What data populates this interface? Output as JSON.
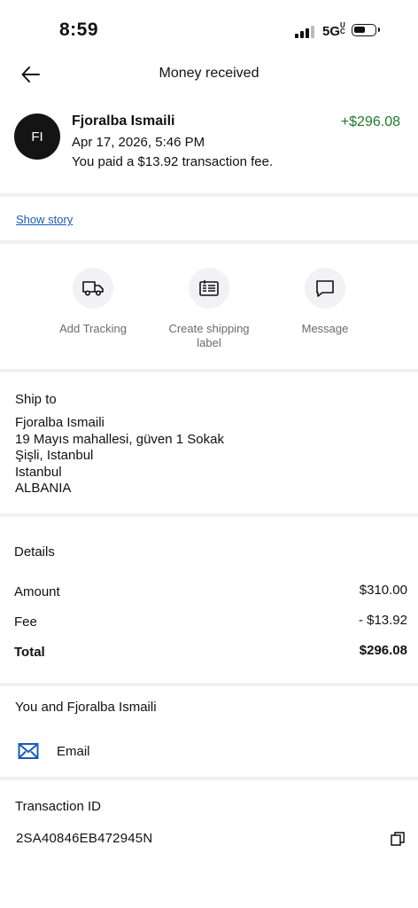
{
  "status_bar": {
    "time": "8:59",
    "network": "5G",
    "network_suffix": "UC"
  },
  "header": {
    "title": "Money received",
    "back_icon": "arrow-left-icon"
  },
  "summary": {
    "initials": "FI",
    "name": "Fjoralba Ismaili",
    "date": "Apr 17, 2026, 5:46 PM",
    "fee_note": "You paid a $13.92 transaction fee.",
    "amount": "+$296.08",
    "amount_color": "#1f7a2c"
  },
  "story_link": "Show story",
  "actions": [
    {
      "label": "Add Tracking",
      "icon": "truck-icon"
    },
    {
      "label": "Create shipping label",
      "icon": "shipping-label-icon"
    },
    {
      "label": "Message",
      "icon": "message-icon"
    }
  ],
  "ship_to": {
    "title": "Ship to",
    "lines": [
      "Fjoralba Ismaili",
      "19 Mayıs mahallesi, güven 1 Sokak",
      "Şişli, Istanbul",
      "Istanbul",
      "ALBANIA"
    ]
  },
  "details": {
    "title": "Details",
    "rows": [
      {
        "label": "Amount",
        "value": "$310.00"
      },
      {
        "label": "Fee",
        "value": "- $13.92"
      },
      {
        "label": "Total",
        "value": "$296.08"
      }
    ]
  },
  "contact": {
    "title": "You and Fjoralba Ismaili",
    "email_label": "Email",
    "icon": "envelope-icon"
  },
  "transaction": {
    "title": "Transaction ID",
    "id": "2SA40846EB472945N",
    "copy_icon": "copy-icon"
  }
}
